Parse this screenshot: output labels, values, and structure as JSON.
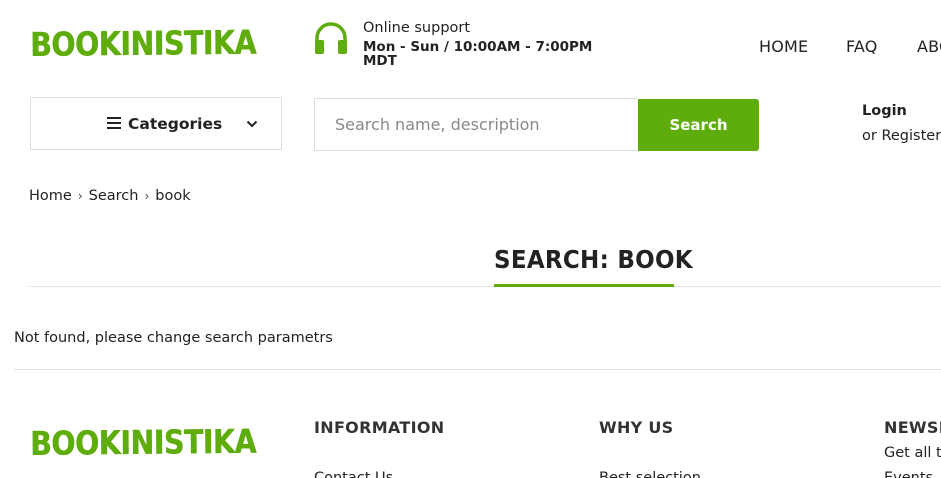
{
  "header": {
    "logo_text": "BOOKINISTIKA",
    "support": {
      "title": "Online support",
      "hours": "Mon - Sun / 10:00AM - 7:00PM MDT",
      "icon": "headset-icon"
    },
    "nav": [
      {
        "label": "HOME"
      },
      {
        "label": "FAQ"
      },
      {
        "label": "ABO"
      }
    ],
    "categories_label": "Categories",
    "search": {
      "placeholder": "Search name, description",
      "value": "",
      "button_label": "Search"
    },
    "account": {
      "login_label": "Login",
      "register_prefix": "or",
      "register_label": "Register"
    }
  },
  "breadcrumb": [
    {
      "label": "Home"
    },
    {
      "label": "Search"
    },
    {
      "label": "book"
    }
  ],
  "main": {
    "title": "SEARCH: BOOK",
    "not_found": "Not found, please change search parametrs"
  },
  "footer": {
    "logo_text": "BOOKINISTIKA",
    "columns": [
      {
        "heading": "INFORMATION",
        "first_link": "Contact Us"
      },
      {
        "heading": "WHY US",
        "first_link": "Best selection"
      },
      {
        "heading": "NEWSL",
        "text": "Get all th",
        "text2": "Events, S"
      }
    ]
  },
  "colors": {
    "accent": "#5fad0c",
    "text": "#222222",
    "border": "#dddddd"
  }
}
